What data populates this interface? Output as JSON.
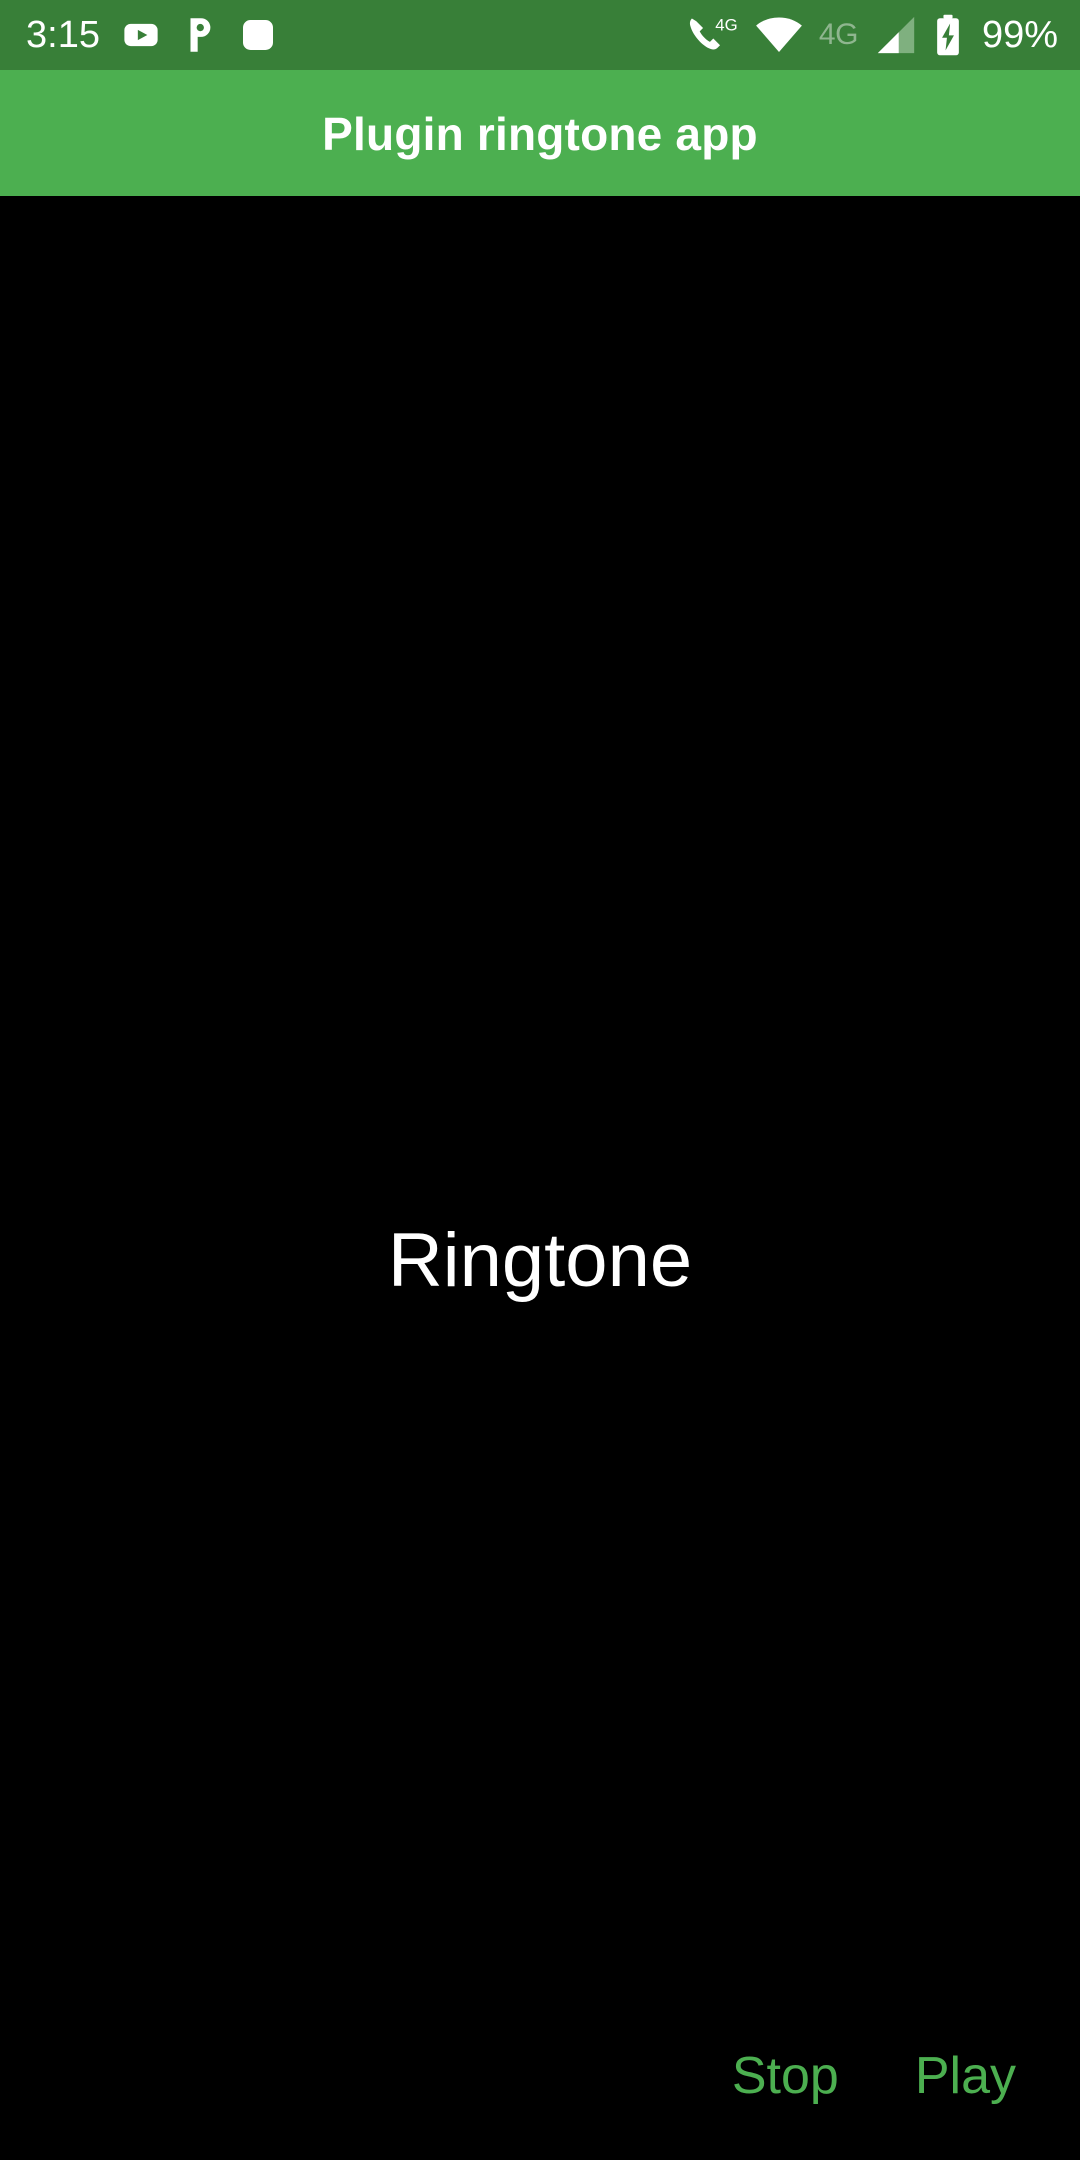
{
  "status_bar": {
    "background_color": "#387f38",
    "foreground_color": "#ffffff",
    "clock": "3:15",
    "battery_percent": "99%",
    "network_label": "4G",
    "volte_label": "4G",
    "left_icons": [
      {
        "name": "youtube-icon",
        "label": "YouTube"
      },
      {
        "name": "pandora-icon",
        "label": "Pandora"
      },
      {
        "name": "generic-app-icon",
        "label": "App notification"
      }
    ],
    "right_icons": [
      {
        "name": "phone-volte-4g-icon",
        "label": "VoLTE 4G call"
      },
      {
        "name": "wifi-icon",
        "label": "Wi-Fi full signal"
      },
      {
        "name": "cellular-signal-icon",
        "label": "Cellular signal"
      },
      {
        "name": "battery-charging-icon",
        "label": "Battery charging"
      }
    ]
  },
  "app_bar": {
    "title": "Plugin ringtone app",
    "background_color": "#4caf50",
    "title_color": "#ffffff"
  },
  "body": {
    "background_color": "#000000",
    "center_label": "Ringtone",
    "center_label_color": "#ffffff"
  },
  "actions": {
    "accent_color": "#4caf50",
    "stop_label": "Stop",
    "play_label": "Play"
  }
}
